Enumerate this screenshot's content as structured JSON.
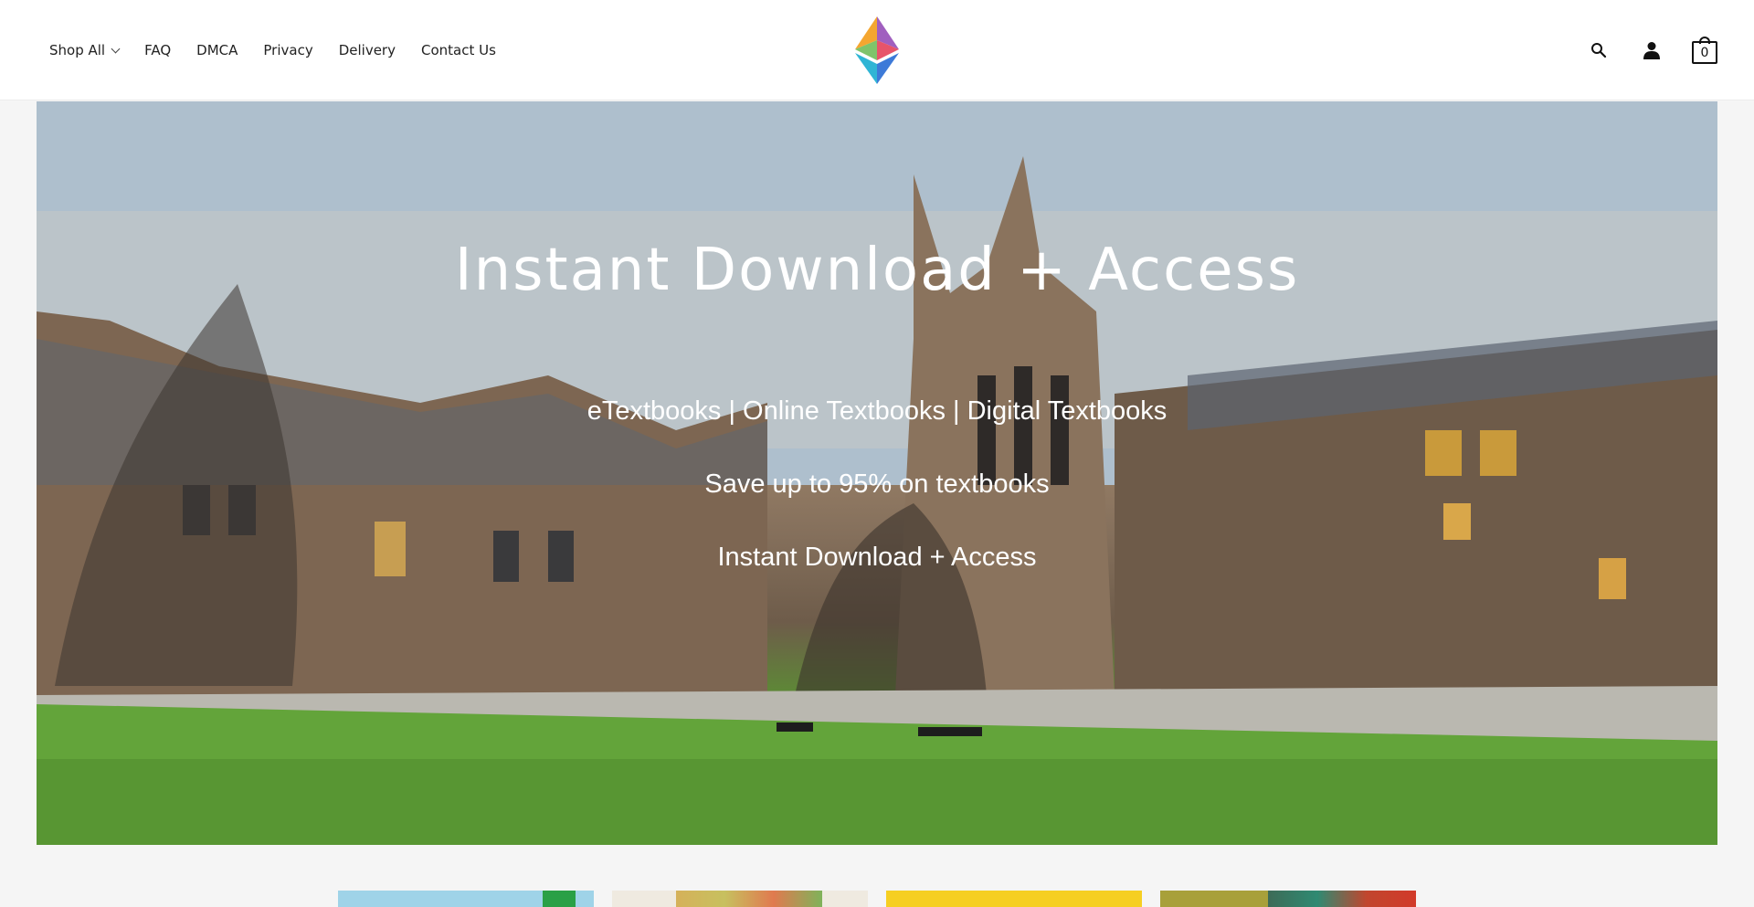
{
  "nav": {
    "shop_all": "Shop All",
    "faq": "FAQ",
    "dmca": "DMCA",
    "privacy": "Privacy",
    "delivery": "Delivery",
    "contact": "Contact Us"
  },
  "header": {
    "logo_icon": "ethereum-diamond-logo",
    "search_icon": "search-icon",
    "account_icon": "user-icon",
    "cart_icon": "cart-icon",
    "cart_count": "0"
  },
  "hero": {
    "title": "Instant Download + Access",
    "line1": "eTextbooks | Online Textbooks | Digital Textbooks",
    "line2": "Save up to 95% on textbooks",
    "line3": "Instant Download + Access"
  },
  "colors": {
    "text": "#222222",
    "hero_text": "#ffffff",
    "background": "#f5f5f5"
  }
}
